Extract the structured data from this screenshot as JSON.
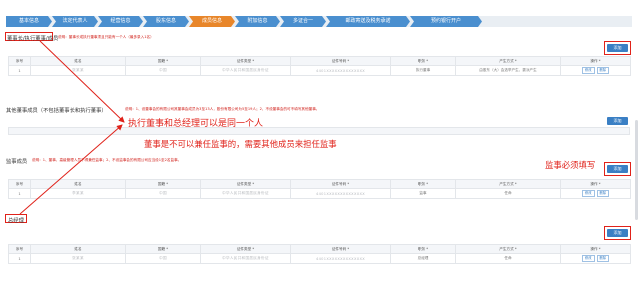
{
  "tabs": [
    {
      "label": "基本信息",
      "active": false
    },
    {
      "label": "法定代表人",
      "active": false
    },
    {
      "label": "经营信息",
      "active": false
    },
    {
      "label": "股东信息",
      "active": false
    },
    {
      "label": "成员信息",
      "active": true
    },
    {
      "label": "附加信息",
      "active": false
    },
    {
      "label": "多证合一",
      "active": false
    },
    {
      "label": "邮政寄送及税务承诺",
      "active": false
    },
    {
      "label": "预约银行开户",
      "active": false
    }
  ],
  "sections": {
    "exec": {
      "title": "董事长/执行董事/成员",
      "note": "说明：董事长或执行董事须且只能有一个人（最多录入1名）",
      "add_label": "添加",
      "rows": [
        {
          "no": "1",
          "name": "张某某",
          "nation": "中国",
          "id_type": "中华人民共和国居民身份证",
          "id_no": "4401XXXXXXXXXXXXXX",
          "position": "执行董事",
          "method": "由股东（大）会选举产生、委派产生",
          "edit": "修改",
          "del": "删除"
        }
      ]
    },
    "other": {
      "title": "其他董事成员（不包括董事长和执行董事）",
      "note": "说明：1、设董事会的有限公司其董事会成员为3至13人，股份有限公司为5至19人；2、不设董事会的可不填写其他董事。",
      "add_label": "添加"
    },
    "supervisor": {
      "title": "监事成员",
      "note": "说明：1、董事、高级管理人员不得兼任监事；2、不设监事会的有限公司应当设1至2名监事。",
      "add_label": "添加",
      "rows": [
        {
          "no": "1",
          "name": "李某某",
          "nation": "中国",
          "id_type": "中华人民共和国居民身份证",
          "id_no": "4401XXXXXXXXXXXXXX",
          "position": "监事",
          "method": "任命",
          "edit": "修改",
          "del": "删除"
        }
      ]
    },
    "manager": {
      "title": "总经理",
      "add_label": "添加",
      "rows": [
        {
          "no": "1",
          "name": "张某某",
          "nation": "中国",
          "id_type": "中华人民共和国居民身份证",
          "id_no": "4401XXXXXXXXXXXXXX",
          "position": "总经理",
          "method": "任命",
          "edit": "修改",
          "del": "删除"
        }
      ]
    }
  },
  "columns": [
    "序号",
    "姓名",
    "国籍 *",
    "证件类型 *",
    "证件号码 *",
    "职务 *",
    "产生方式 *",
    "操作 *"
  ],
  "annotations": {
    "a1": "执行董事和总经理可以是同一个人",
    "a2": "董事是不可以兼任监事的，需要其他成员来担任监事",
    "a3": "监事必须填写"
  },
  "colors": {
    "accent": "#e8862a",
    "tab": "#4a8fcf",
    "button": "#3a7fc4",
    "annotation": "#e0221a"
  }
}
